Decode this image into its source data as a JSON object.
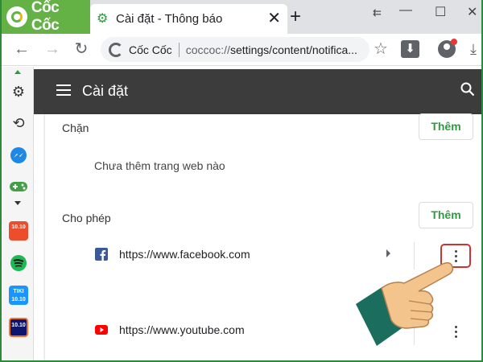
{
  "browser": {
    "brand": "Cốc Cốc",
    "tab_title": "Cài đặt - Thông báo",
    "tab_close": "✕",
    "new_tab": "+",
    "window_controls": [
      "⇇",
      "—",
      "☐",
      "✕"
    ],
    "omnibox_site": "Cốc Cốc",
    "url_prefix": "coccoc://",
    "url_path": "settings/content/notifica...",
    "accent_color": "#64b146"
  },
  "sidebar": {
    "items": [
      {
        "name": "settings-icon"
      },
      {
        "name": "history-icon"
      },
      {
        "name": "messenger-icon"
      },
      {
        "name": "gamepad-icon"
      },
      {
        "name": "shopee-app",
        "label": "10.10"
      },
      {
        "name": "spotify-icon"
      },
      {
        "name": "tiki-app",
        "label": "TIKI 10.10"
      },
      {
        "name": "lazada-app",
        "label": "10.10"
      }
    ]
  },
  "header": {
    "title": "Cài đặt"
  },
  "blocked": {
    "label": "Chặn",
    "add_button": "Thêm",
    "empty_message": "Chưa thêm trang web nào"
  },
  "allowed": {
    "label": "Cho phép",
    "add_button": "Thêm",
    "sites": [
      {
        "url": "https://www.facebook.com",
        "icon": "facebook-icon"
      },
      {
        "url": "https://www.youtube.com",
        "icon": "youtube-icon"
      }
    ]
  }
}
